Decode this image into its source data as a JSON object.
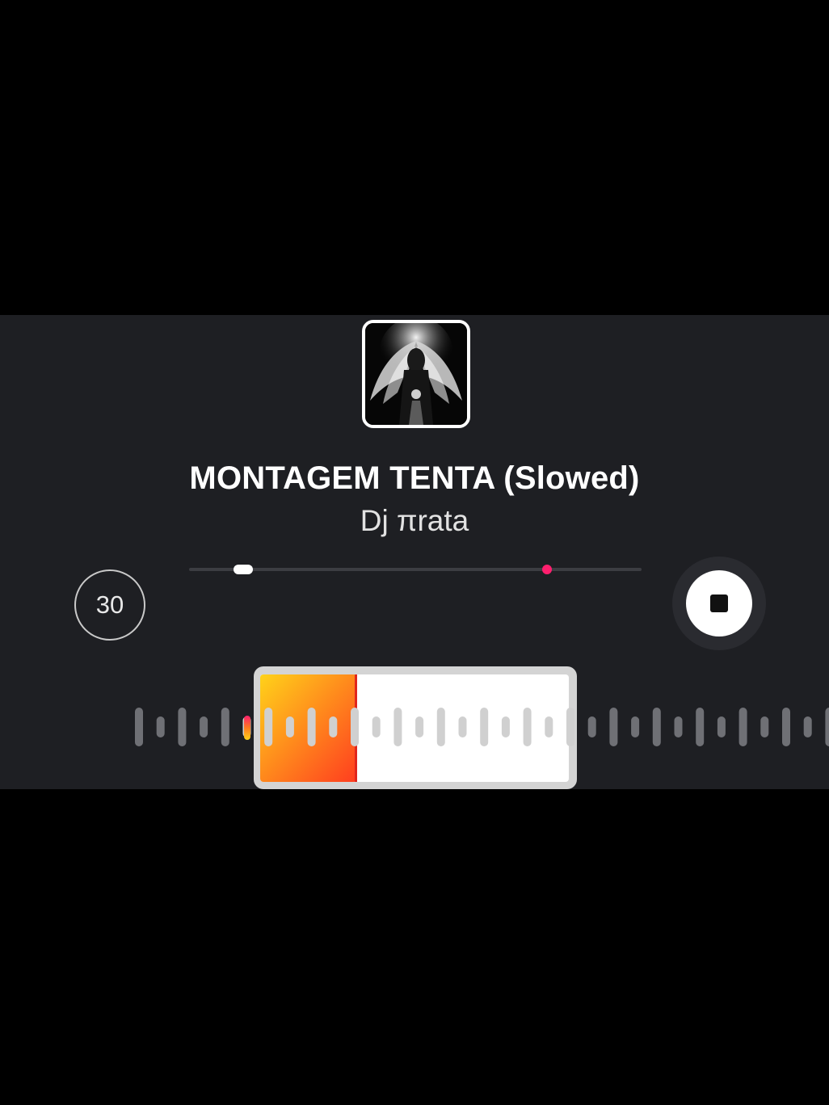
{
  "track": {
    "title": "MONTAGEM TENTA (Slowed)",
    "artist": "Dj πrata"
  },
  "cover": {
    "icon": "angel-wings-cover-art-icon"
  },
  "controls": {
    "duration_label": "30",
    "stop_icon": "stop-icon"
  },
  "progress": {
    "position_fraction": 0.12,
    "marker_fraction": 0.79
  },
  "clip_selector": {
    "played_fraction": 0.32
  },
  "colors": {
    "background": "#000000",
    "panel": "#1e1f23",
    "accent_pink": "#ff1f6e",
    "accent_gradient_start": "#ffd21a",
    "accent_gradient_end": "#ff3d1f",
    "playhead": "#e0261c"
  }
}
